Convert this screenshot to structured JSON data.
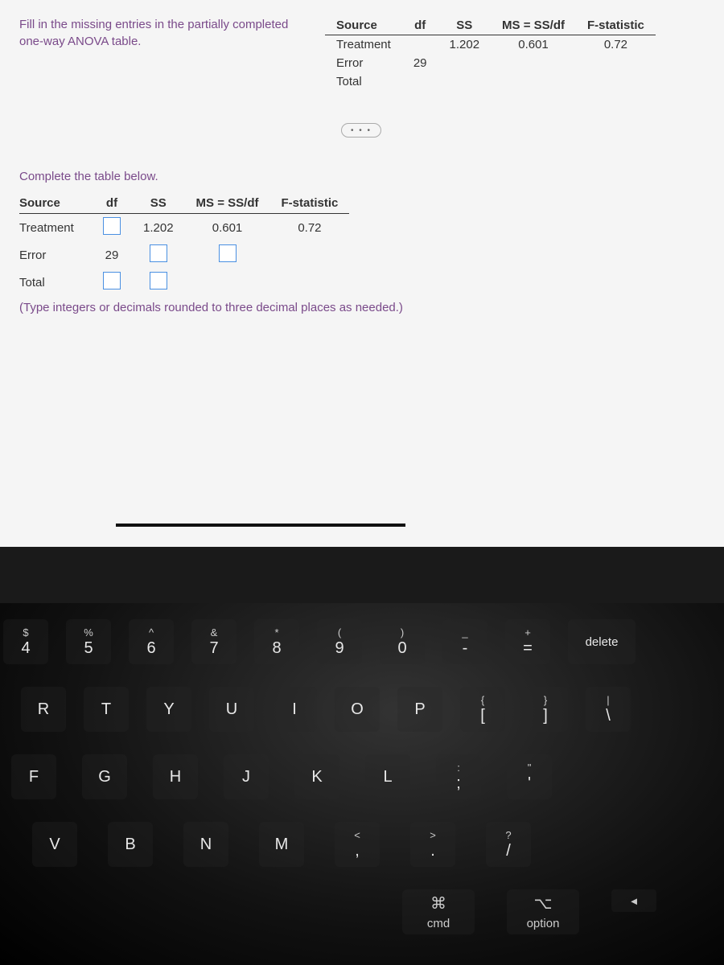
{
  "instruction": "Fill in the missing entries in the partially completed one-way ANOVA table.",
  "ref_table": {
    "headers": [
      "Source",
      "df",
      "SS",
      "MS = SS/df",
      "F-statistic"
    ],
    "rows": [
      {
        "source": "Treatment",
        "df": "",
        "ss": "1.202",
        "ms": "0.601",
        "f": "0.72"
      },
      {
        "source": "Error",
        "df": "29",
        "ss": "",
        "ms": "",
        "f": ""
      },
      {
        "source": "Total",
        "df": "",
        "ss": "",
        "ms": "",
        "f": ""
      }
    ]
  },
  "subheading": "Complete the table below.",
  "edit_table": {
    "headers": [
      "Source",
      "df",
      "SS",
      "MS = SS/df",
      "F-statistic"
    ],
    "rows": [
      {
        "source": "Treatment",
        "df_input": true,
        "ss": "1.202",
        "ms": "0.601",
        "f": "0.72"
      },
      {
        "source": "Error",
        "df": "29",
        "ss_input": true,
        "ms_input": true,
        "f": ""
      },
      {
        "source": "Total",
        "df_input": true,
        "ss_input": true,
        "ms": "",
        "f": ""
      }
    ]
  },
  "hint": "(Type integers or decimals rounded to three decimal places as needed.)",
  "keyboard": {
    "row1": [
      {
        "upper": "$",
        "lower": "4"
      },
      {
        "upper": "%",
        "lower": "5"
      },
      {
        "upper": "^",
        "lower": "6"
      },
      {
        "upper": "&",
        "lower": "7"
      },
      {
        "upper": "*",
        "lower": "8"
      },
      {
        "upper": "(",
        "lower": "9"
      },
      {
        "upper": ")",
        "lower": "0"
      },
      {
        "upper": "_",
        "lower": "-"
      },
      {
        "upper": "+",
        "lower": "="
      }
    ],
    "delete": "delete",
    "row2": [
      "R",
      "T",
      "Y",
      "U",
      "I",
      "O",
      "P"
    ],
    "row2_brackets": [
      {
        "upper": "{",
        "lower": "["
      },
      {
        "upper": "}",
        "lower": "]"
      }
    ],
    "row2_pipe": {
      "upper": "|",
      "lower": "\\"
    },
    "row3": [
      "F",
      "G",
      "H",
      "J",
      "K",
      "L"
    ],
    "row3_punct": [
      {
        "upper": ":",
        "lower": ";"
      },
      {
        "upper": "\"",
        "lower": "'"
      }
    ],
    "row4": [
      "V",
      "B",
      "N",
      "M"
    ],
    "row4_punct": [
      {
        "upper": "<",
        "lower": ","
      },
      {
        "upper": ">",
        "lower": "."
      },
      {
        "upper": "?",
        "lower": "/"
      }
    ],
    "cmd_sym": "⌘",
    "cmd_label": "cmd",
    "opt_sym": "⌥",
    "opt_label": "option",
    "arrow": "◄"
  }
}
